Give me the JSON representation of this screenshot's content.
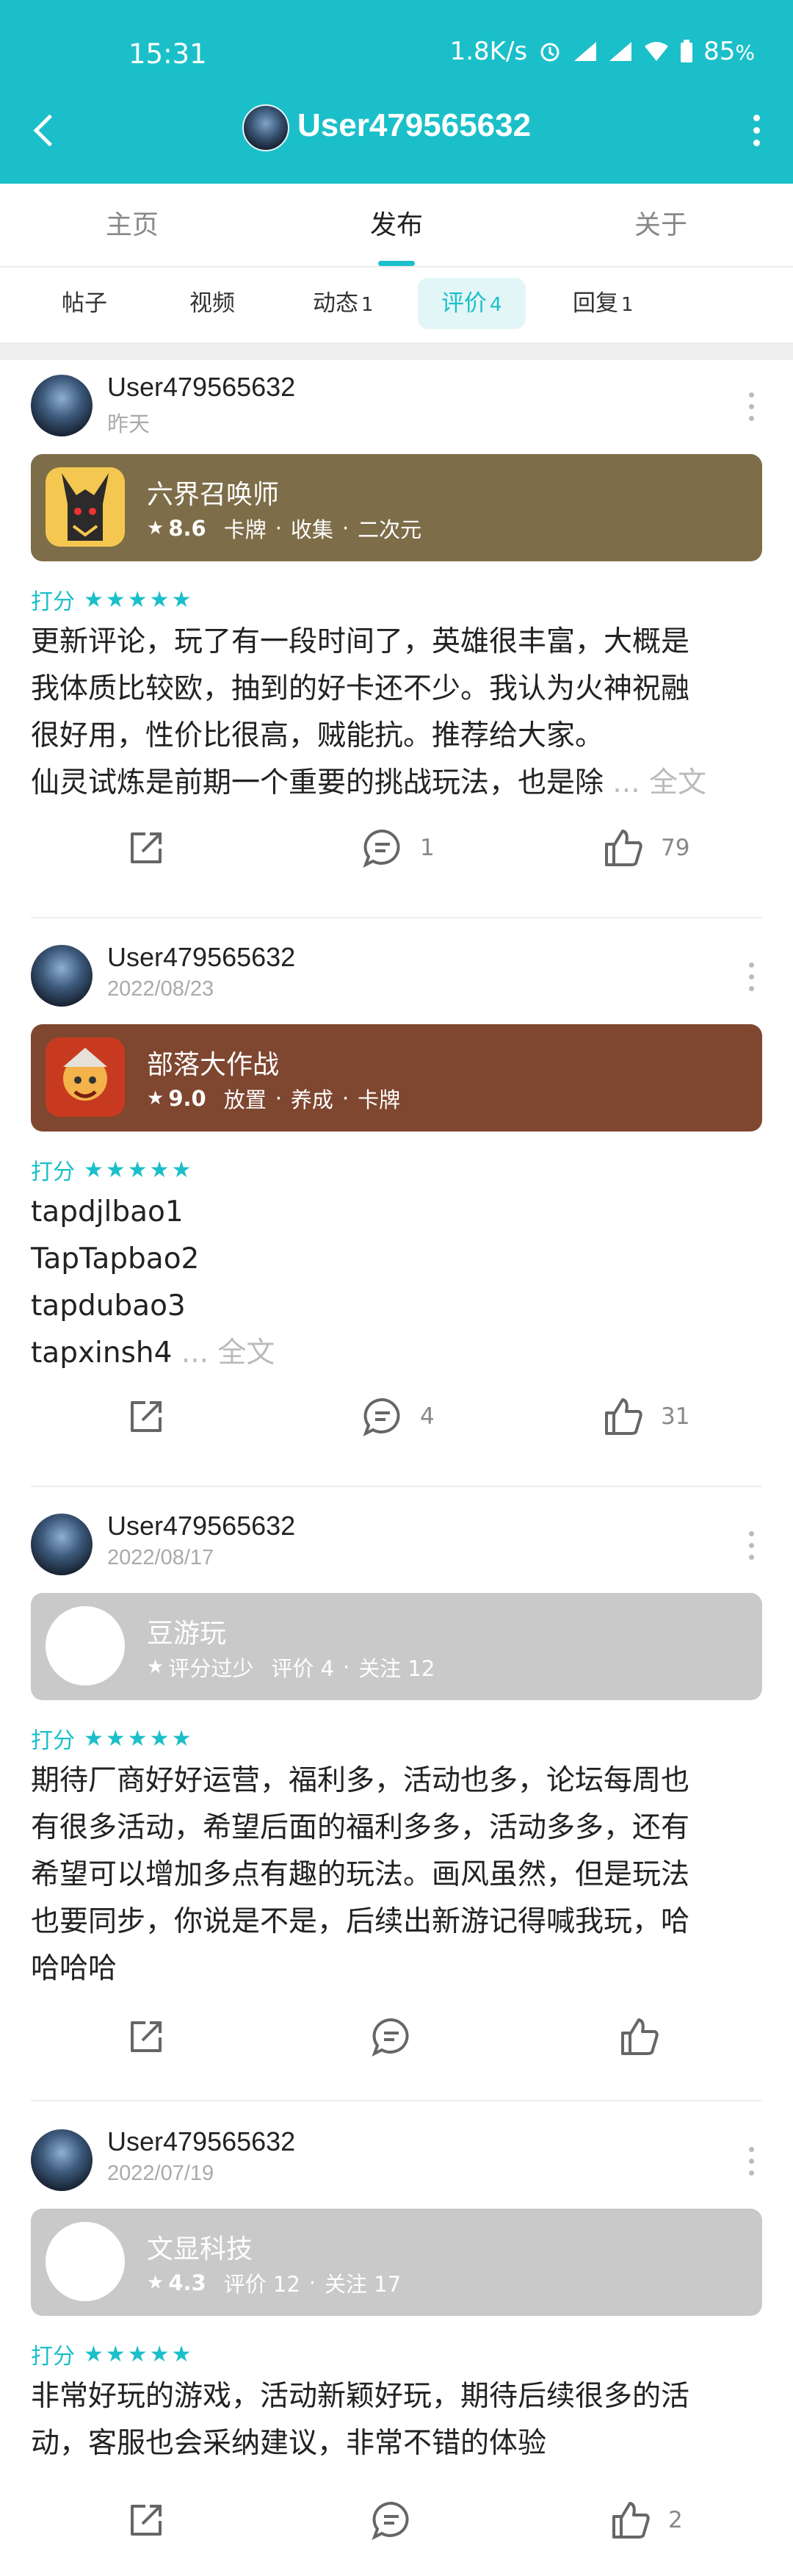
{
  "status_bar": {
    "time": "15:31",
    "net_speed": "1.8K/s",
    "battery": "85"
  },
  "header": {
    "title": "User479565632",
    "accent_color": "#1bbfc9"
  },
  "main_tabs": [
    {
      "label": "主页"
    },
    {
      "label": "发布"
    },
    {
      "label": "关于"
    }
  ],
  "sub_tabs": [
    {
      "label": "帖子",
      "count": ""
    },
    {
      "label": "视频",
      "count": ""
    },
    {
      "label": "动态",
      "count": "1"
    },
    {
      "label": "评价",
      "count": "4"
    },
    {
      "label": "回复",
      "count": "1"
    }
  ],
  "score_label": "打分",
  "score_stars": "★★★★★",
  "reviews": [
    {
      "user": "User479565632",
      "date": "昨天",
      "game": {
        "name": "六界召唤师",
        "rating": "8.6",
        "tags": [
          "卡牌",
          "收集",
          "二次元"
        ],
        "color": "#7e6d49",
        "icon": "anubis-icon"
      },
      "text": "更新评论，玩了有一段时间了，英雄很丰富，大概是\n我体质比较欧，抽到的好卡还不少。我认为火神祝融\n很好用，性价比很高，贼能抗。推荐给大家。\n仙灵试炼是前期一个重要的挑战玩法，也是除",
      "more": " ... 全文",
      "comments": "1",
      "likes": "79"
    },
    {
      "user": "User479565632",
      "date": "2022/08/23",
      "game": {
        "name": "部落大作战",
        "rating": "9.0",
        "tags": [
          "放置",
          "养成",
          "卡牌"
        ],
        "color": "#7f4630",
        "icon": "warrior-icon"
      },
      "text": "tapdjlbao1\nTapTapbao2\ntapdubao3\ntapxinsh4",
      "more": " ... 全文",
      "comments": "4",
      "likes": "31"
    },
    {
      "user": "User479565632",
      "date": "2022/08/17",
      "game": {
        "name": "豆游玩",
        "rating": "评分过少",
        "tags": [
          "评价 4",
          "关注 12"
        ],
        "color": "#c9c9c9",
        "icon": "placeholder-icon"
      },
      "text": "期待厂商好好运营，福利多，活动也多，论坛每周也\n有很多活动，希望后面的福利多多，活动多多，还有\n希望可以增加多点有趣的玩法。画风虽然，但是玩法\n也要同步，你说是不是，后续出新游记得喊我玩，哈\n哈哈哈",
      "more": "",
      "comments": "",
      "likes": ""
    },
    {
      "user": "User479565632",
      "date": "2022/07/19",
      "game": {
        "name": "文显科技",
        "rating": "4.3",
        "tags": [
          "评价 12",
          "关注 17"
        ],
        "color": "#c9c9c9",
        "icon": "placeholder-icon"
      },
      "text": "非常好玩的游戏，活动新颖好玩，期待后续很多的活\n动，客服也会采纳建议，非常不错的体验",
      "more": "",
      "comments": "",
      "likes": "2"
    }
  ]
}
